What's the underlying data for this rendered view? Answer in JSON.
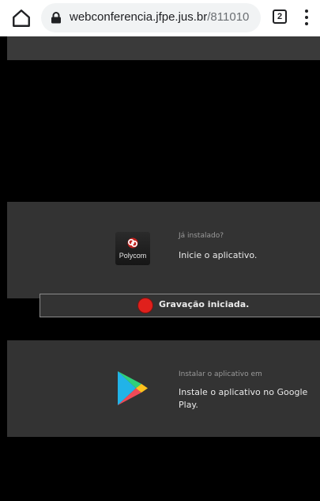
{
  "browser": {
    "url_domain": "webconferencia.jfpe.jus.br",
    "url_path": "/811010",
    "tab_count": "2",
    "icons": [
      "home-icon",
      "lock-icon",
      "tab-switcher-icon",
      "more-menu-icon"
    ]
  },
  "installed": {
    "prompt": "Já instalado?",
    "action": "Inicie o aplicativo.",
    "logo_text": "Polycom"
  },
  "recording": {
    "message": "Gravação iniciada.",
    "indicator_color": "#e0201c"
  },
  "store": {
    "prompt": "Instalar o aplicativo em",
    "action": "Instale o aplicativo no Google Play."
  },
  "colors": {
    "page_background": "#000000",
    "panel_background": "#333333",
    "chrome_background": "#ffffff"
  }
}
